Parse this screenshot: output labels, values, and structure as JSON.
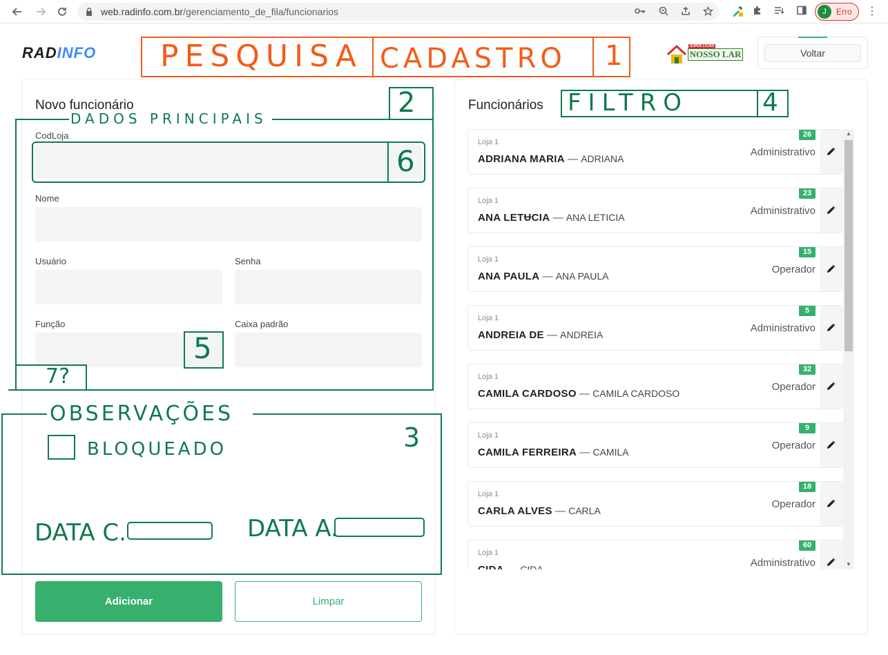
{
  "browser": {
    "url_host": "web.radinfo.com.br",
    "url_path": "/gerenciamento_de_fila/funcionarios",
    "profile_initial": "J",
    "profile_status": "Erro"
  },
  "header": {
    "logo_part1": "RAD",
    "logo_part2": "INFO",
    "brand_tag": "SUPER LOJAS",
    "brand_name": "NOSSO LAR",
    "back_label": "Voltar"
  },
  "form": {
    "title": "Novo funcionário",
    "fields": {
      "codloja": "CodLoja",
      "nome": "Nome",
      "usuario": "Usuário",
      "senha": "Senha",
      "funcao": "Função",
      "caixa_padrao": "Caixa padrão"
    },
    "add_label": "Adicionar",
    "clear_label": "Limpar"
  },
  "list": {
    "title": "Funcionários",
    "employees": [
      {
        "store": "Loja 1",
        "name": "ADRIANA MARIA",
        "user": "ADRIANA",
        "role": "Administrativo",
        "badge": "26"
      },
      {
        "store": "Loja 1",
        "name": "ANA LETɄCIA",
        "user": "ANA LETICIA",
        "role": "Administrativo",
        "badge": "23"
      },
      {
        "store": "Loja 1",
        "name": "ANA PAULA",
        "user": "ANA PAULA",
        "role": "Operador",
        "badge": "15"
      },
      {
        "store": "Loja 1",
        "name": "ANDREIA DE",
        "user": "ANDREIA",
        "role": "Administrativo",
        "badge": "5"
      },
      {
        "store": "Loja 1",
        "name": "CAMILA CARDOSO",
        "user": "CAMILA CARDOSO",
        "role": "Operador",
        "badge": "32"
      },
      {
        "store": "Loja 1",
        "name": "CAMILA FERREIRA",
        "user": "CAMILA",
        "role": "Operador",
        "badge": "9"
      },
      {
        "store": "Loja 1",
        "name": "CARLA ALVES",
        "user": "CARLA",
        "role": "Operador",
        "badge": "18"
      },
      {
        "store": "Loja 1",
        "name": "CIDA",
        "user": "CIDA",
        "role": "Administrativo",
        "badge": "60"
      }
    ]
  },
  "annotations": {
    "pesquisa": "PESQUISA",
    "cadastro": "CADASTRO",
    "num1": "1",
    "num2": "2",
    "num3": "3",
    "num4": "4",
    "num5": "5",
    "num6": "6",
    "num7": "7?",
    "filtro": "FILTRO",
    "dados": "DADOS PRINCIPAIS",
    "observacoes": "OBSERVAÇÕES",
    "bloqueado": "BLOQUEADO",
    "data_c": "DATA C.",
    "data_a": "DATA A."
  },
  "colors": {
    "accent_green": "#37b06e",
    "annotation_orange": "#f25c19",
    "annotation_green": "#0e7a4c",
    "logo_blue": "#3d8bfd"
  }
}
